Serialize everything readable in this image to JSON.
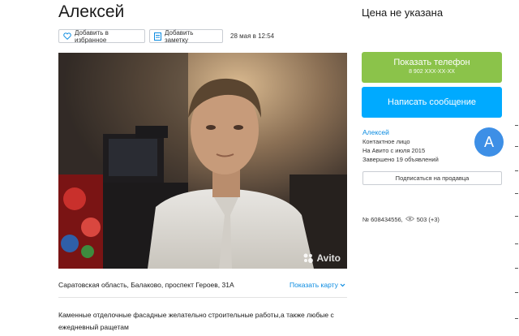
{
  "listing": {
    "title": "Алексей",
    "price": "Цена не указана",
    "date": "28 мая в 12:54",
    "address": "Саратовская область, Балаково, проспект Героев, 31А",
    "description": "Каменные отделочные фасадные желательно строительные работы,а также любые с ежедневный ращетам"
  },
  "actions": {
    "favorite_label": "Добавить в избранное",
    "note_label": "Добавить заметку",
    "show_map_label": "Показать карту"
  },
  "photo": {
    "watermark": "Avito"
  },
  "contact": {
    "phone_button_label": "Показать телефон",
    "phone_masked": "8 902 XXX-XX-XX",
    "message_button_label": "Написать сообщение"
  },
  "seller": {
    "name": "Алексей",
    "role": "Контактное лицо",
    "member_since": "На Авито с июля 2015",
    "completed": "Завершено 19 объявлений",
    "avatar_letter": "A",
    "subscribe_label": "Подписаться на продавца"
  },
  "ad_meta": {
    "number": "№ 608434556,",
    "views": "503 (+3)"
  },
  "colors": {
    "phone_button": "#8bc34a",
    "message_button": "#00aaff",
    "link": "#0a8be1",
    "avatar": "#3d8fe6"
  }
}
